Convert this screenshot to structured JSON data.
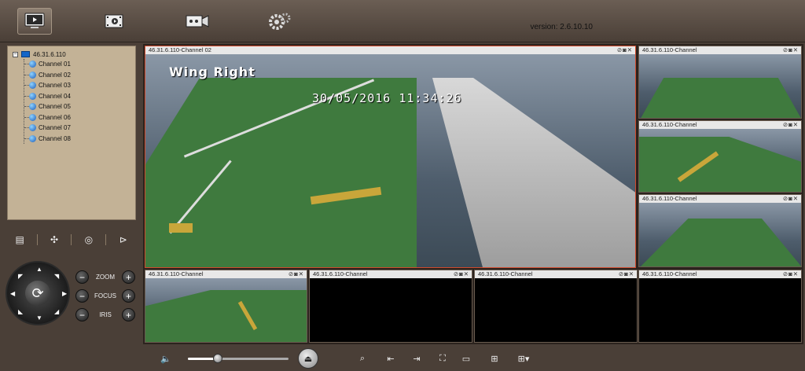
{
  "toolbar": {
    "items": [
      {
        "name": "live-view",
        "icon": "monitor-play-icon",
        "active": true
      },
      {
        "name": "playback",
        "icon": "film-playback-icon",
        "active": false
      },
      {
        "name": "record",
        "icon": "video-record-icon",
        "active": false
      },
      {
        "name": "settings",
        "icon": "gear-icon",
        "active": false
      }
    ],
    "version": "version: 2.6.10.10"
  },
  "device_tree": {
    "root_toggle": "−",
    "root_label": "46.31.6.110",
    "channels": [
      "Channel 01",
      "Channel 02",
      "Channel 03",
      "Channel 04",
      "Channel 05",
      "Channel 06",
      "Channel 07",
      "Channel 08"
    ]
  },
  "ptz": {
    "tools": [
      "preset-icon",
      "patrol-icon",
      "track-icon",
      "pattern-icon"
    ],
    "zoom_label": "ZOOM",
    "focus_label": "FOCUS",
    "iris_label": "IRIS",
    "minus": "−",
    "plus": "+",
    "center_glyph": "⟳"
  },
  "panes": [
    {
      "title": "46.31.6.110-Channel 02",
      "osd_title": "Wing Right",
      "osd_time": "30/05/2016 11:34:26",
      "selected": true
    },
    {
      "title": "46.31.6.110-Channel"
    },
    {
      "title": "46.31.6.110-Channel"
    },
    {
      "title": "46.31.6.110-Channel"
    },
    {
      "title": "46.31.6.110-Channel"
    },
    {
      "title": "46.31.6.110-Channel"
    },
    {
      "title": "46.31.6.110-Channel"
    },
    {
      "title": "46.31.6.110-Channel"
    }
  ],
  "pane_controls": "⊘◙✕",
  "bottom": {
    "volume_icon": "🔈",
    "volume_level": 0.3,
    "eject_glyph": "⏏",
    "layout_icons": [
      "zoom-icon",
      "prev-page-icon",
      "next-page-icon",
      "fullscreen-icon",
      "layout-1-icon",
      "layout-4-icon",
      "layout-more-icon"
    ]
  },
  "colors": {
    "selected_border": "#d04a2c",
    "deck_green": "#3f7a3e"
  }
}
